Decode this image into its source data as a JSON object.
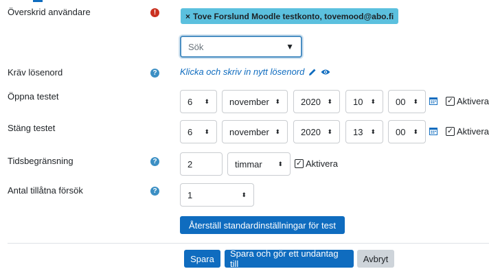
{
  "fields": {
    "override_users": {
      "label": "Överskrid användare",
      "chip_remove": "×",
      "chip_text": "Tove Forslund Moodle testkonto, tovemood@abo.fi",
      "search_placeholder": "Sök"
    },
    "require_password": {
      "label": "Kräv lösenord",
      "link_text": "Klicka och skriv in nytt lösenord"
    },
    "open_quiz": {
      "label": "Öppna testet",
      "day": "6",
      "month": "november",
      "year": "2020",
      "hour": "10",
      "minute": "00",
      "enable_label": "Aktivera",
      "enabled": true
    },
    "close_quiz": {
      "label": "Stäng testet",
      "day": "6",
      "month": "november",
      "year": "2020",
      "hour": "13",
      "minute": "00",
      "enable_label": "Aktivera",
      "enabled": true
    },
    "time_limit": {
      "label": "Tidsbegränsning",
      "value": "2",
      "unit": "timmar",
      "enable_label": "Aktivera",
      "enabled": true
    },
    "attempts": {
      "label": "Antal tillåtna försök",
      "value": "1"
    }
  },
  "buttons": {
    "reset": "Återställ standardinställningar för test",
    "save": "Spara",
    "save_another": "Spara och gör ett undantag till",
    "cancel": "Avbryt"
  },
  "icons": {
    "required": "exclamation-icon",
    "help": "question-icon",
    "edit": "pencil-icon",
    "reveal": "eye-icon",
    "calendar": "calendar-icon",
    "check": "check-icon"
  },
  "colors": {
    "primary": "#0f6cbf",
    "chip": "#5bc0de",
    "required": "#ca3120",
    "help": "#3b8fc4",
    "secondary_button": "#ced4da"
  }
}
